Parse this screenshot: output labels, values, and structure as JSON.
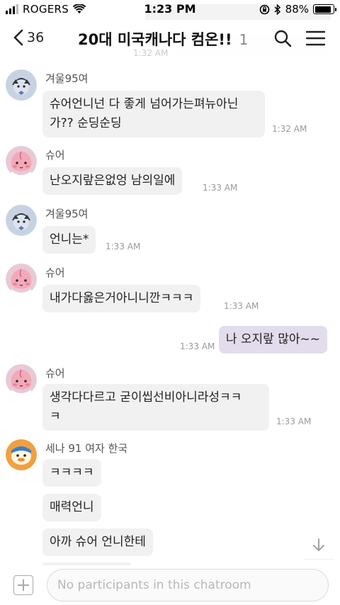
{
  "status_bar": {
    "carrier": "ROGERS",
    "time": "1:23 PM",
    "battery_percent": "88%",
    "battery_level": 0.88,
    "icons": [
      "signal-icon",
      "wifi-icon",
      "rotation-lock-icon",
      "bluetooth-icon",
      "battery-icon"
    ]
  },
  "header": {
    "back_count": "36",
    "title": "20대 미국캐나다 컴온!!",
    "member_count": "1",
    "icons": [
      "back-chevron-icon",
      "search-icon",
      "hamburger-menu-icon"
    ]
  },
  "messages": [
    {
      "sender": "겨울95여",
      "avatar": "gray-character",
      "lines": [
        "슈어언니넌 다 좋게 넘어가는펴뉴아닌",
        "가?? 순딩순딩"
      ],
      "time": "1:32 AM"
    },
    {
      "sender": "슈어",
      "avatar": "apeach",
      "lines": [
        "난오지랖은없엉 남의일에"
      ],
      "time": "1:33 AM"
    },
    {
      "sender": "겨울95여",
      "avatar": "gray-character",
      "lines": [
        "언니는*"
      ],
      "time": "1:33 AM"
    },
    {
      "sender": "슈어",
      "avatar": "apeach",
      "lines": [
        "내가다옳은거아니니깐ㅋㅋㅋ"
      ],
      "time": "1:33 AM"
    },
    {
      "mine": true,
      "lines": [
        "나 오지랖 많아~~"
      ],
      "time": "1:33 AM"
    },
    {
      "sender": "슈어",
      "avatar": "apeach",
      "lines": [
        "생각다다르고 굳이씹선비아니라성ㅋㅋ",
        "ㅋ"
      ],
      "time": "1:33 AM"
    },
    {
      "sender": "세나 91 여자 한국",
      "avatar": "tube",
      "lines": [
        "ㅋㅋㅋㅋ"
      ]
    },
    {
      "lines": [
        "매력언니"
      ]
    },
    {
      "lines": [
        "아까 슈어 언니한테"
      ]
    }
  ],
  "input": {
    "placeholder": "No participants in this chatroom"
  },
  "colors": {
    "incoming_bubble": "#f1f1f2",
    "outgoing_bubble": "#e3dcec",
    "apeach_avatar_bg": "#e8c9d6",
    "gray_avatar_bg": "#c7d2e3",
    "tube_avatar_bg": "#f0a040"
  }
}
